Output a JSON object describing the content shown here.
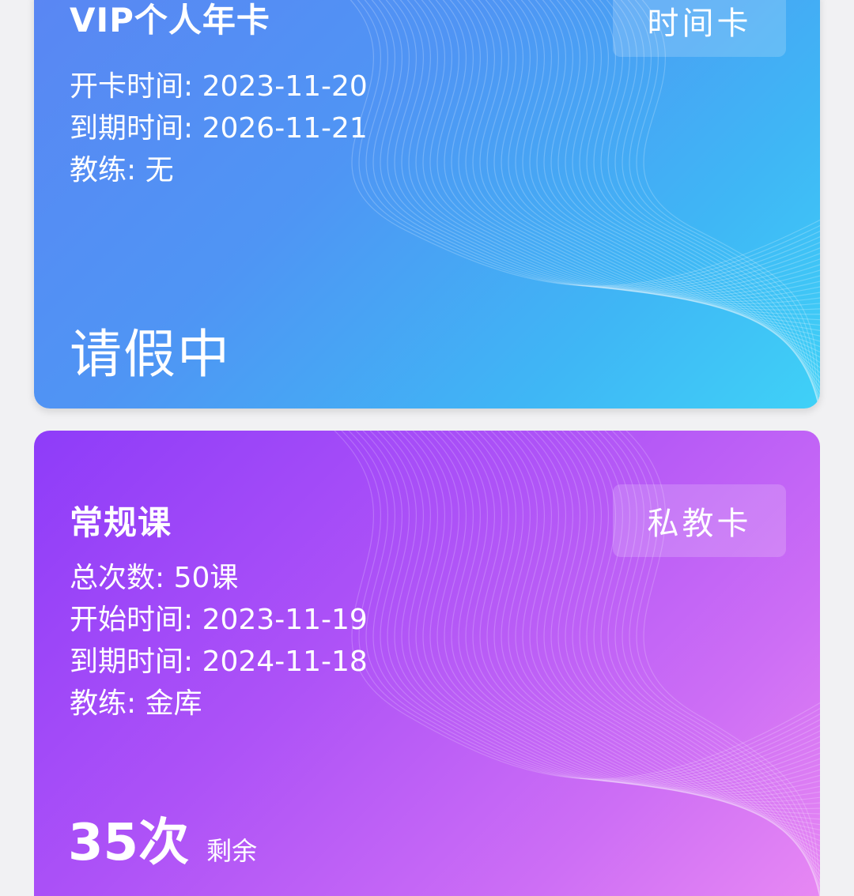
{
  "vip_card": {
    "name": "VIP个人年卡",
    "type": "时间卡",
    "start_label": "开卡时间:",
    "start_date": "2023-11-20",
    "expire_label": "到期时间:",
    "expire_date": "2026-11-21",
    "coach_label": "教练:",
    "coach": "无",
    "status": "请假中",
    "colors": {
      "from": "#5a86f3",
      "to": "#3fd1f7"
    }
  },
  "pt_card": {
    "name": "常规课",
    "type": "私教卡",
    "total_label": "总次数:",
    "total": "50课",
    "start_label": "开始时间:",
    "start_date": "2023-11-19",
    "expire_label": "到期时间:",
    "expire_date": "2024-11-18",
    "coach_label": "教练:",
    "coach": "金库",
    "remaining": "35次",
    "remaining_label": "剩余",
    "colors": {
      "from": "#8e3cf9",
      "to": "#e98af3"
    }
  }
}
